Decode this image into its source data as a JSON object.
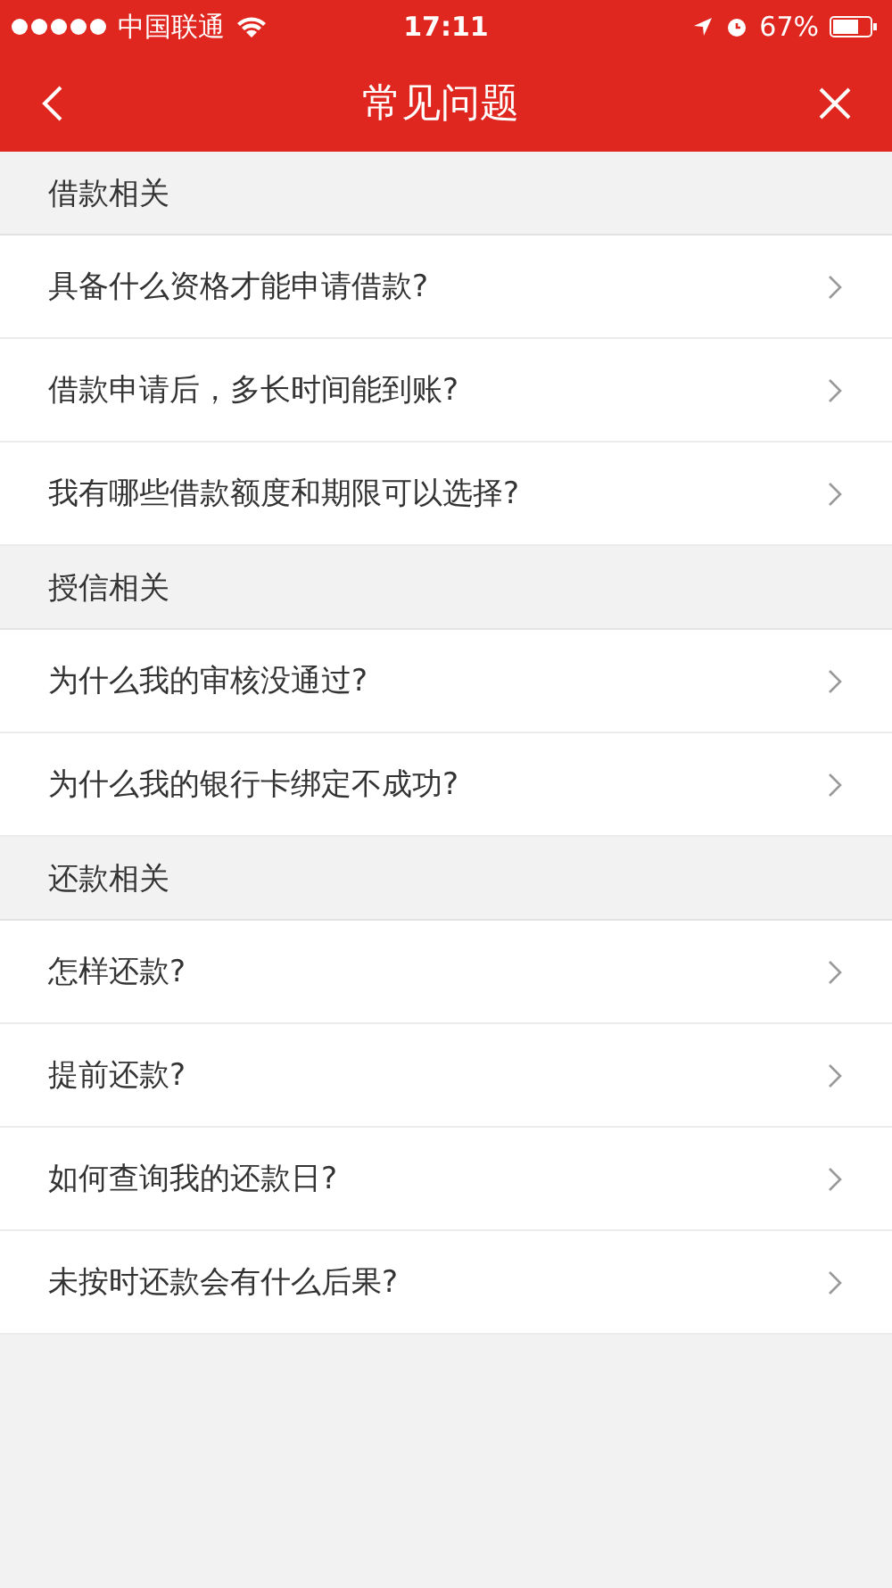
{
  "status_bar": {
    "carrier": "中国联通",
    "time": "17:11",
    "battery": "67%"
  },
  "nav": {
    "title": "常见问题"
  },
  "sections": [
    {
      "title": "借款相关",
      "items": [
        "具备什么资格才能申请借款?",
        "借款申请后，多长时间能到账?",
        "我有哪些借款额度和期限可以选择?"
      ]
    },
    {
      "title": "授信相关",
      "items": [
        "为什么我的审核没通过?",
        "为什么我的银行卡绑定不成功?"
      ]
    },
    {
      "title": "还款相关",
      "items": [
        "怎样还款?",
        "提前还款?",
        "如何查询我的还款日?",
        "未按时还款会有什么后果?"
      ]
    }
  ]
}
